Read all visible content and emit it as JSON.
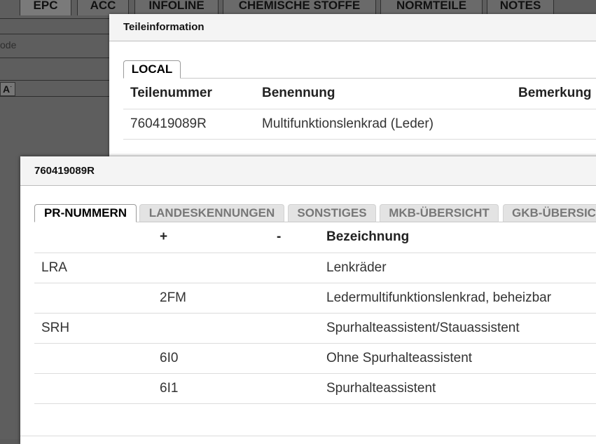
{
  "background": {
    "tabs": [
      "EPC",
      "ACC",
      "INFOLINE",
      "CHEMISCHE STOFFE",
      "NORMTEILE",
      "NOTES"
    ],
    "code_label": "ode",
    "font_button": "A",
    "font_button_sup": "˙"
  },
  "teileinfo": {
    "title": "Teileinformation",
    "tabs": [
      {
        "label": "LOCAL",
        "active": true
      }
    ],
    "columns": [
      "Teilenummer",
      "Benennung",
      "Bemerkung"
    ],
    "rows": [
      [
        "760419089R",
        "Multifunktionslenkrad (Leder)",
        ""
      ]
    ]
  },
  "part_dialog": {
    "title": "760419089R",
    "tabs": [
      {
        "label": "PR-NUMMERN",
        "active": true
      },
      {
        "label": "LANDESKENNUNGEN",
        "active": false
      },
      {
        "label": "SONSTIGES",
        "active": false
      },
      {
        "label": "MKB-ÜBERSICHT",
        "active": false
      },
      {
        "label": "GKB-ÜBERSICHT",
        "active": false
      }
    ],
    "columns": [
      "",
      "+",
      "-",
      "Bezeichnung"
    ],
    "rows": [
      [
        "LRA",
        "",
        "",
        "Lenkräder"
      ],
      [
        "",
        "2FM",
        "",
        "Ledermultifunktionslenkrad, beheizbar"
      ],
      [
        "SRH",
        "",
        "",
        "Spurhalteassistent/Stauassistent"
      ],
      [
        "",
        "6I0",
        "",
        "Ohne Spurhalteassistent"
      ],
      [
        "",
        "6I1",
        "",
        "Spurhalteassistent"
      ]
    ]
  }
}
